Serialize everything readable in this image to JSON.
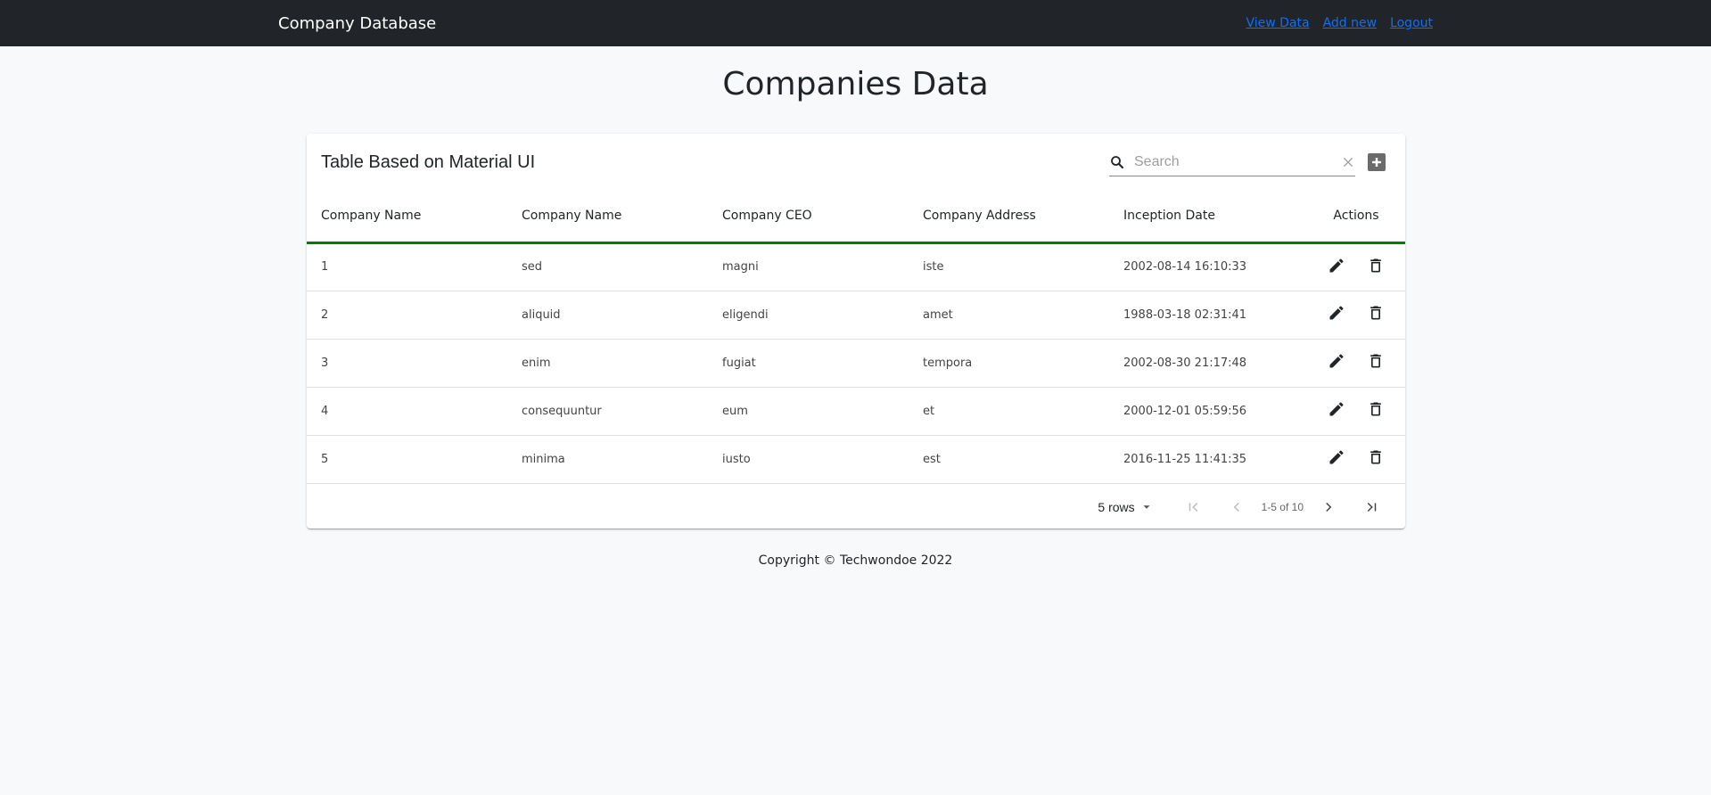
{
  "navbar": {
    "brand": "Company Database",
    "links": [
      "View Data",
      "Add new",
      "Logout"
    ]
  },
  "page": {
    "title": "Companies Data"
  },
  "table": {
    "title": "Table Based on Material UI",
    "search_placeholder": "Search",
    "columns": [
      "Company Name",
      "Company Name",
      "Company CEO",
      "Company Address",
      "Inception Date",
      "Actions"
    ],
    "rows": [
      [
        "1",
        "sed",
        "magni",
        "iste",
        "2002-08-14 16:10:33"
      ],
      [
        "2",
        "aliquid",
        "eligendi",
        "amet",
        "1988-03-18 02:31:41"
      ],
      [
        "3",
        "enim",
        "fugiat",
        "tempora",
        "2002-08-30 21:17:48"
      ],
      [
        "4",
        "consequuntur",
        "eum",
        "et",
        "2000-12-01 05:59:56"
      ],
      [
        "5",
        "minima",
        "iusto",
        "est",
        "2016-11-25 11:41:35"
      ]
    ],
    "pagination": {
      "rows_label": "5 rows",
      "range": "1-5 of 10"
    }
  },
  "footer": {
    "text": "Copyright © Techwondoe 2022"
  },
  "icons": {
    "search": "search-icon",
    "clear": "close-icon",
    "add": "add-box-icon",
    "edit": "pencil-icon",
    "delete": "trash-icon",
    "first": "first-page-icon",
    "prev": "chevron-left-icon",
    "next": "chevron-right-icon",
    "last": "last-page-icon",
    "dropdown": "caret-down-icon"
  },
  "colors": {
    "navbar": "#212529",
    "link": "#0d6efd",
    "header_border": "#008000"
  }
}
